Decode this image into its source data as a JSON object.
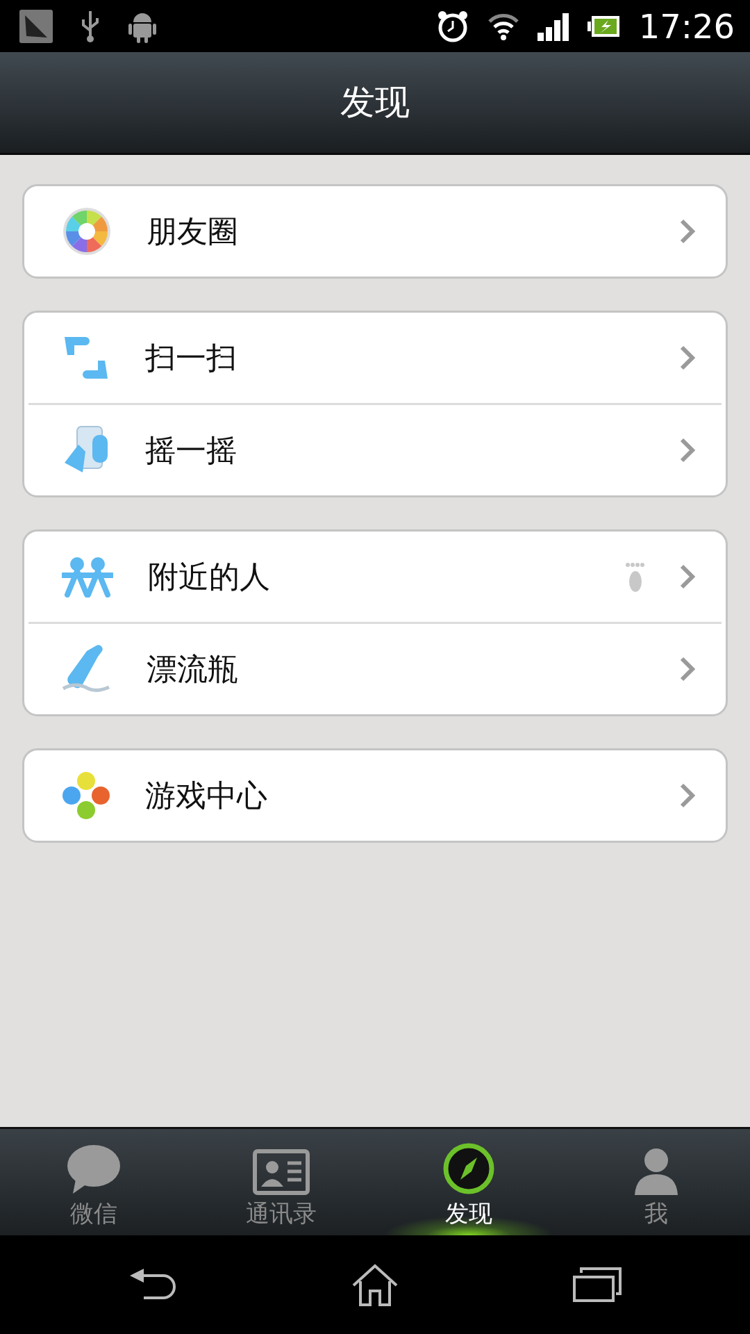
{
  "status_bar": {
    "time": "17:26"
  },
  "header": {
    "title": "发现"
  },
  "groups": [
    {
      "items": [
        {
          "label": "朋友圈",
          "footprint": false
        }
      ]
    },
    {
      "items": [
        {
          "label": "扫一扫",
          "footprint": false
        },
        {
          "label": "摇一摇",
          "footprint": false
        }
      ]
    },
    {
      "items": [
        {
          "label": "附近的人",
          "footprint": true
        },
        {
          "label": "漂流瓶",
          "footprint": false
        }
      ]
    },
    {
      "items": [
        {
          "label": "游戏中心",
          "footprint": false
        }
      ]
    }
  ],
  "tabs": [
    {
      "label": "微信",
      "selected": false
    },
    {
      "label": "通讯录",
      "selected": false
    },
    {
      "label": "发现",
      "selected": true
    },
    {
      "label": "我",
      "selected": false
    }
  ]
}
